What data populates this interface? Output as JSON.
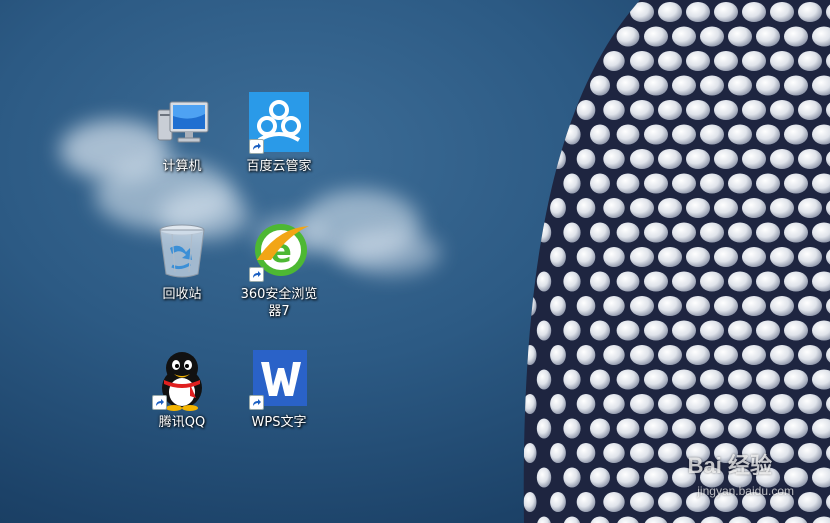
{
  "desktop": {
    "icons": [
      {
        "label": "计算机",
        "icon": "computer-icon"
      },
      {
        "label": "百度云管家",
        "icon": "baidu-cloud-icon"
      },
      {
        "label": "回收站",
        "icon": "recycle-bin-icon"
      },
      {
        "label": "360安全浏览器7",
        "icon": "360-browser-icon"
      },
      {
        "label": "腾讯QQ",
        "icon": "qq-penguin-icon"
      },
      {
        "label": "WPS文字",
        "icon": "wps-writer-icon"
      }
    ],
    "watermark": {
      "text": "Bai 经验",
      "url": "jingyan.baidu.com"
    },
    "colors": {
      "sky": "#2c5a84",
      "dome": "#1e2540",
      "baidu_blue": "#2a9ae8",
      "wps_blue": "#2a62c8",
      "browser_green": "#4db833"
    }
  }
}
